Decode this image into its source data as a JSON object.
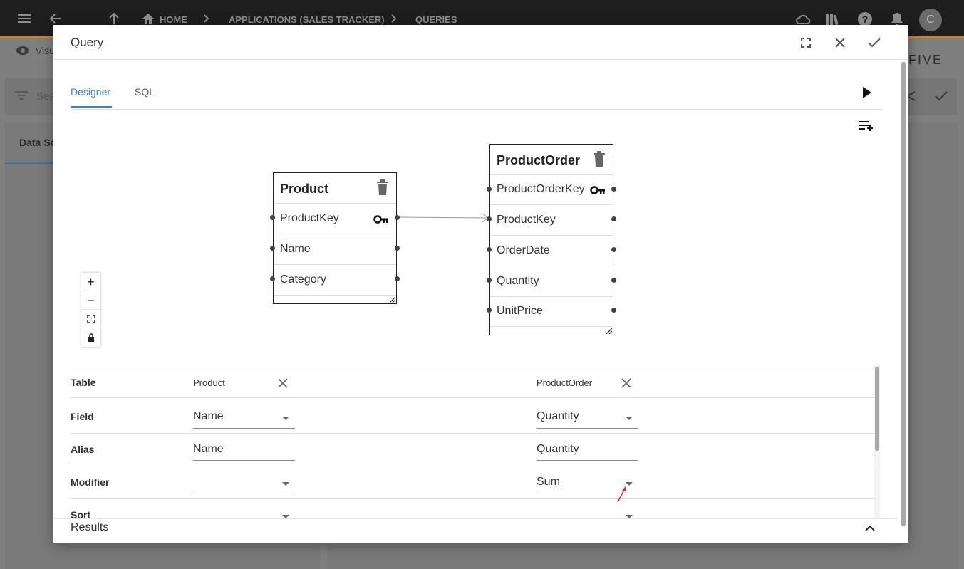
{
  "app": {
    "breadcrumb": [
      "HOME",
      "APPLICATIONS (SALES TRACKER)",
      "QUERIES"
    ],
    "avatar_initial": "C",
    "sub_toolbar_label": "Visu",
    "search_placeholder": "Sea",
    "left_tab": "Data So",
    "brand": "FIVE"
  },
  "dialog": {
    "title": "Query",
    "tabs": [
      {
        "label": "Designer",
        "active": true
      },
      {
        "label": "SQL",
        "active": false
      }
    ]
  },
  "diagram": {
    "tables": [
      {
        "name": "Product",
        "fields": [
          "ProductKey",
          "Name",
          "Category"
        ],
        "key_field": "ProductKey"
      },
      {
        "name": "ProductOrder",
        "fields": [
          "ProductOrderKey",
          "ProductKey",
          "OrderDate",
          "Quantity",
          "UnitPrice"
        ],
        "key_field": "ProductOrderKey"
      }
    ],
    "zoom_controls": [
      "+",
      "−"
    ]
  },
  "grid": {
    "row_labels": [
      "Table",
      "Field",
      "Alias",
      "Modifier",
      "Sort"
    ],
    "columns": [
      {
        "table": "Product",
        "field": "Name",
        "alias": "Name",
        "modifier": "",
        "sort": ""
      },
      {
        "table": "ProductOrder",
        "field": "Quantity",
        "alias": "Quantity",
        "modifier": "Sum",
        "sort": ""
      }
    ]
  },
  "results": {
    "label": "Results"
  },
  "colors": {
    "accent": "#3f7fc8",
    "topbar": "#1e1e1e",
    "topbar_border": "#c8862a",
    "annotation_arrow": "#e02020"
  }
}
